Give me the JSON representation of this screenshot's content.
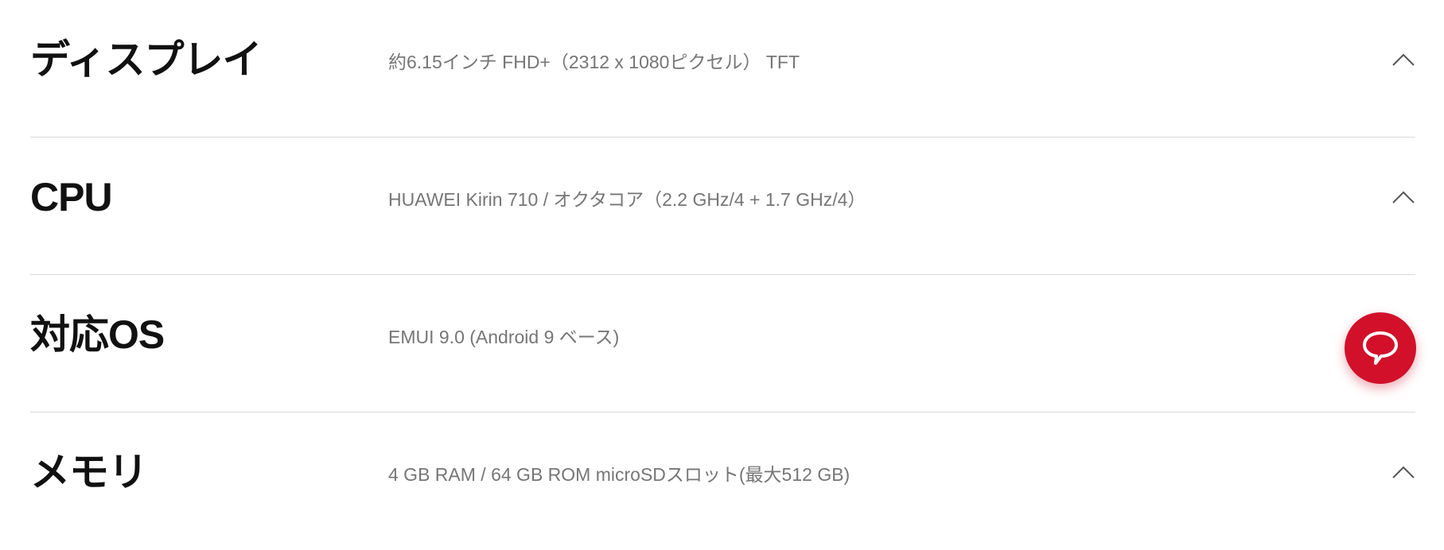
{
  "specs": [
    {
      "label": "ディスプレイ",
      "value": "約6.15インチ FHD+（2312 x 1080ピクセル） TFT",
      "icon": "chevron-up-icon"
    },
    {
      "label": "CPU",
      "value": "HUAWEI Kirin 710 / オクタコア（2.2 GHz/4 + 1.7 GHz/4）",
      "icon": "chevron-up-icon"
    },
    {
      "label": "対応OS",
      "value": "EMUI 9.0 (Android 9 ベース)",
      "icon": "chevron-up-icon"
    },
    {
      "label": "メモリ",
      "value": "4 GB RAM / 64 GB ROM microSDスロット(最大512 GB)",
      "icon": "chevron-up-icon"
    }
  ],
  "chat": {
    "icon": "chat-bubble-icon",
    "color": "#d2102a"
  },
  "colors": {
    "label": "#111111",
    "value": "#767676",
    "divider": "#d9d9d9",
    "accent": "#d2102a"
  }
}
